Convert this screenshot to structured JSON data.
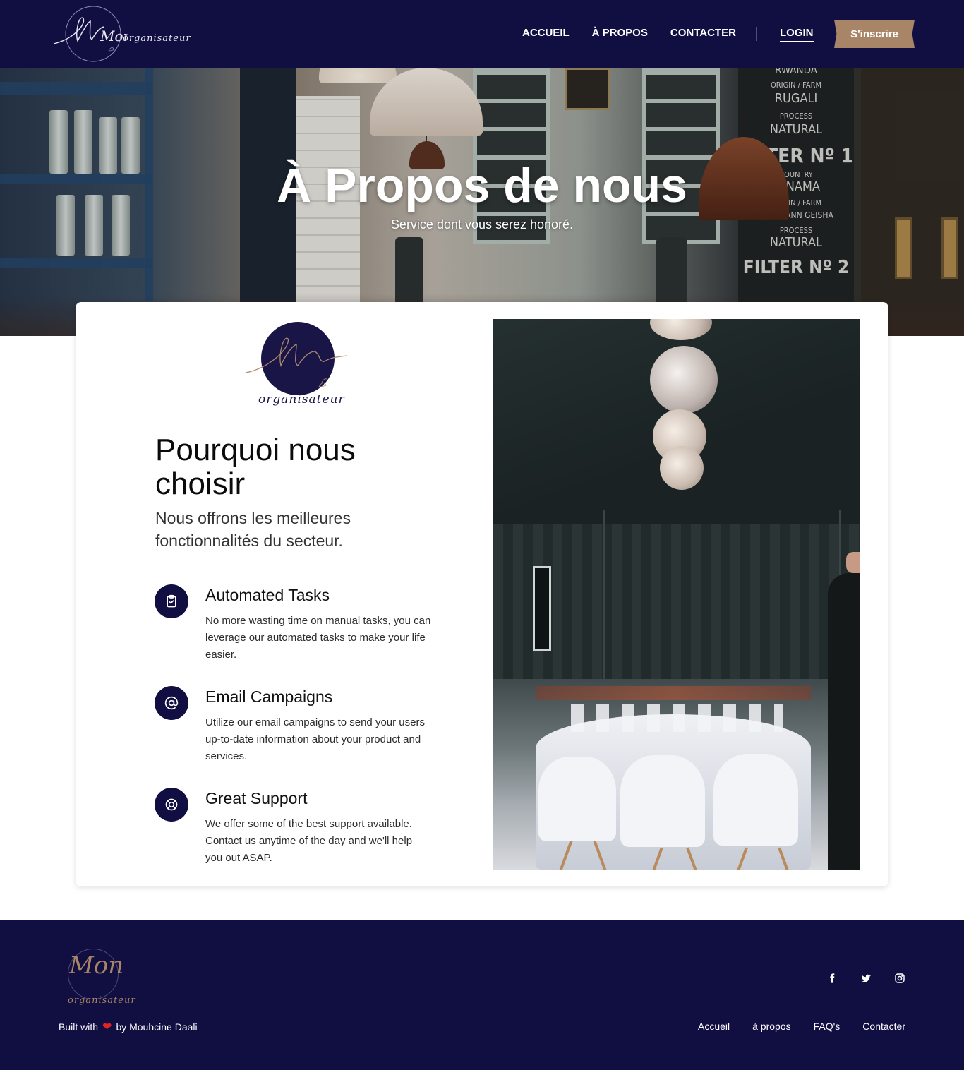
{
  "brand": {
    "logo_script": "Mon",
    "logo_name": "organisateur"
  },
  "nav": {
    "items": [
      {
        "label": "ACCUEIL"
      },
      {
        "label": "À PROPOS"
      },
      {
        "label": "CONTACTER"
      }
    ],
    "login_label": "LOGIN",
    "signup_label": "S'inscrire"
  },
  "hero": {
    "title": "À Propos de nous",
    "subtitle": "Service dont vous serez honoré.",
    "board_lines": [
      "RWANDA",
      "ORIGIN / FARM",
      "RUGALI",
      "PROCESS",
      "NATURAL",
      "FILTER Nº 1",
      "COUNTRY",
      "PANAMA",
      "ORIGIN / FARM",
      "HARTMANN GEISHA",
      "PROCESS",
      "NATURAL",
      "FILTER Nº 2"
    ]
  },
  "about": {
    "title": "Pourquoi nous choisir",
    "subtitle": "Nous offrons les meilleures fonctionnalités du secteur.",
    "features": [
      {
        "title": "Automated Tasks",
        "description": "No more wasting time on manual tasks, you can leverage our automated tasks to make your life easier.",
        "icon": "clipboard-check-icon"
      },
      {
        "title": "Email Campaigns",
        "description": "Utilize our email campaigns to send your users up-to-date information about your product and services.",
        "icon": "at-sign-icon"
      },
      {
        "title": "Great Support",
        "description": "We offer some of the best support available. Contact us anytime of the day and we'll help you out ASAP.",
        "icon": "lifebuoy-icon"
      }
    ]
  },
  "footer": {
    "credit_prefix": "Built with",
    "credit_suffix": "by Mouhcine Daali",
    "social": [
      "facebook-icon",
      "twitter-icon",
      "instagram-icon"
    ],
    "links": [
      {
        "label": "Accueil"
      },
      {
        "label": "à propos"
      },
      {
        "label": "FAQ's"
      },
      {
        "label": "Contacter"
      }
    ]
  },
  "colors": {
    "navy": "#110e42",
    "accent": "#a88566",
    "heart": "#e02424"
  }
}
